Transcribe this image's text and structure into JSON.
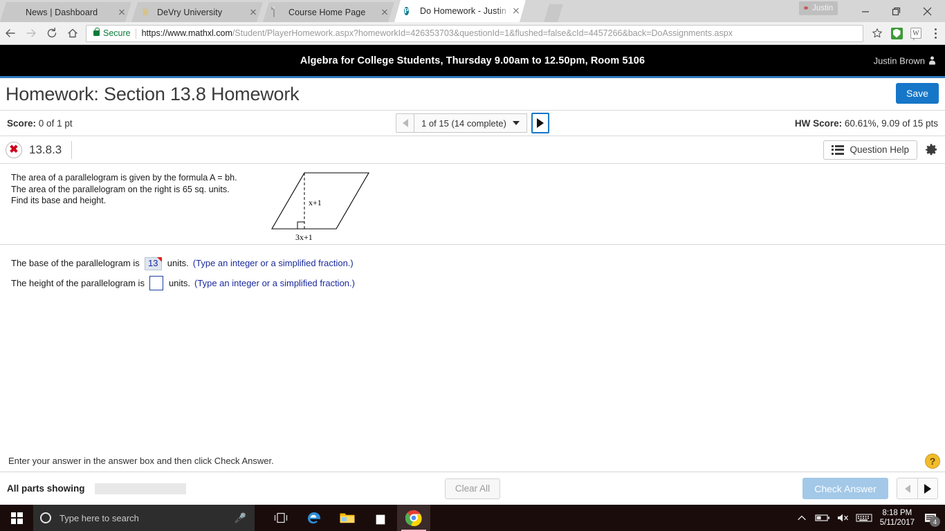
{
  "browser": {
    "tabs": [
      {
        "title": "News | Dashboard",
        "favicon": "shield-star-icon",
        "active": false
      },
      {
        "title": "DeVry University",
        "favicon": "devry-crest-icon",
        "active": false
      },
      {
        "title": "Course Home Page",
        "favicon": "document-icon",
        "active": false
      },
      {
        "title": "Do Homework - Justin B",
        "favicon": "pearson-icon",
        "active": true
      }
    ],
    "profile_name": "Justin",
    "security_label": "Secure",
    "url_domain": "https://www.mathxl.com",
    "url_path": "/Student/PlayerHomework.aspx?homeworkId=426353703&questionId=1&flushed=false&cId=4457266&back=DoAssignments.aspx",
    "url_full": "https://www.mathxl.com/Student/PlayerHomework.aspx?homeworkId=426353703&questionId=1&flushed=false&cId=4457266&back=DoAssignments.aspx",
    "extension_w_label": "W"
  },
  "course_bar": {
    "title": "Algebra for College Students, Thursday 9.00am to 12.50pm, Room 5106",
    "user": "Justin Brown"
  },
  "header": {
    "title": "Homework: Section 13.8 Homework",
    "save_label": "Save"
  },
  "score_row": {
    "score_label": "Score:",
    "score_value": "0 of 1 pt",
    "pager_text": "1 of 15 (14 complete)",
    "hw_score_label": "HW Score:",
    "hw_score_value": "60.61%, 9.09 of 15 pts"
  },
  "question_header": {
    "status": "incorrect",
    "status_glyph": "✖",
    "number": "13.8.3",
    "help_label": "Question Help"
  },
  "question": {
    "text_line1": "The area of a parallelogram is given by the formula A = bh.",
    "text_line2": "The area of the parallelogram on the right is 65 sq. units.",
    "text_line3": "Find its base and height.",
    "figure": {
      "height_label": "x+1",
      "base_label": "3x+1"
    },
    "answers": [
      {
        "prefix": "The base of the parallelogram is",
        "value": "13",
        "filled": true,
        "units": "units.",
        "hint": "(Type an integer or a simplified fraction.)"
      },
      {
        "prefix": "The height of the parallelogram is",
        "value": "",
        "filled": false,
        "units": "units.",
        "hint": "(Type an integer or a simplified fraction.)"
      }
    ]
  },
  "footer": {
    "hint": "Enter your answer in the answer box and then click Check Answer.",
    "all_parts_label": "All parts showing",
    "progress_percent": 100,
    "clear_all_label": "Clear All",
    "check_answer_label": "Check Answer",
    "help_fab_glyph": "?"
  },
  "taskbar": {
    "search_placeholder": "Type here to search",
    "time": "8:18 PM",
    "date": "5/11/2017",
    "notification_count": "4"
  }
}
